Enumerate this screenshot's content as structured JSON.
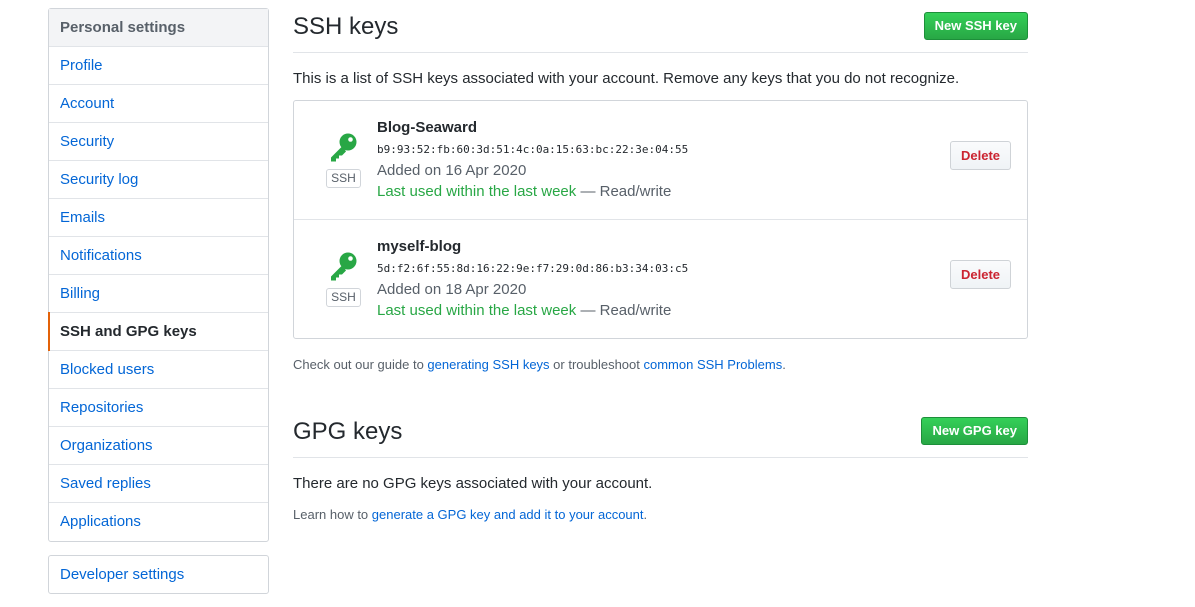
{
  "sidebar": {
    "header": "Personal settings",
    "items": [
      {
        "label": "Profile"
      },
      {
        "label": "Account"
      },
      {
        "label": "Security"
      },
      {
        "label": "Security log"
      },
      {
        "label": "Emails"
      },
      {
        "label": "Notifications"
      },
      {
        "label": "Billing"
      },
      {
        "label": "SSH and GPG keys",
        "selected": true
      },
      {
        "label": "Blocked users"
      },
      {
        "label": "Repositories"
      },
      {
        "label": "Organizations"
      },
      {
        "label": "Saved replies"
      },
      {
        "label": "Applications"
      }
    ],
    "developer_settings": "Developer settings"
  },
  "ssh": {
    "title": "SSH keys",
    "new_button": "New SSH key",
    "description": "This is a list of SSH keys associated with your account. Remove any keys that you do not recognize.",
    "keys": [
      {
        "title": "Blog-Seaward",
        "fingerprint": "b9:93:52:fb:60:3d:51:4c:0a:15:63:bc:22:3e:04:55",
        "added": "Added on 16 Apr 2020",
        "last_used": "Last used within the last week",
        "access": " — Read/write",
        "badge": "SSH",
        "delete_label": "Delete"
      },
      {
        "title": "myself-blog",
        "fingerprint": "5d:f2:6f:55:8d:16:22:9e:f7:29:0d:86:b3:34:03:c5",
        "added": "Added on 18 Apr 2020",
        "last_used": "Last used within the last week",
        "access": " — Read/write",
        "badge": "SSH",
        "delete_label": "Delete"
      }
    ],
    "help": {
      "prefix": "Check out our guide to ",
      "link1": "generating SSH keys",
      "middle": " or troubleshoot ",
      "link2": "common SSH Problems",
      "suffix": "."
    }
  },
  "gpg": {
    "title": "GPG keys",
    "new_button": "New GPG key",
    "empty_text": "There are no GPG keys associated with your account.",
    "help": {
      "prefix": "Learn how to ",
      "link": "generate a GPG key and add it to your account",
      "suffix": "."
    }
  },
  "colors": {
    "link": "#0366d6",
    "green": "#28a745",
    "danger": "#cb2431",
    "selected_marker": "#e36209"
  },
  "icons": {
    "key": "key-icon"
  }
}
